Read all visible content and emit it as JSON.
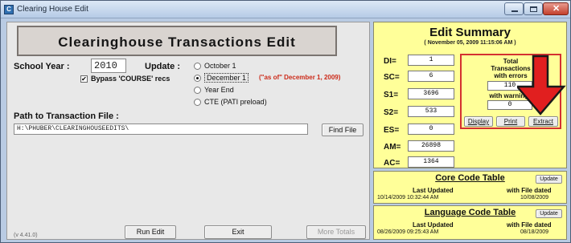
{
  "window": {
    "title": "Clearing House Edit",
    "app_icon": "app-icon"
  },
  "header": {
    "title": "Clearinghouse Transactions Edit"
  },
  "form": {
    "school_year_label": "School Year :",
    "school_year_value": "2010",
    "update_label": "Update :",
    "bypass_label": "Bypass 'COURSE' recs",
    "bypass_checked": true,
    "radio_options": [
      {
        "label": "October 1",
        "selected": false
      },
      {
        "label": "December 1",
        "selected": true
      },
      {
        "label": "Year End",
        "selected": false
      },
      {
        "label": "CTE (PATI preload)",
        "selected": false
      }
    ],
    "as_of_note": "(\"as of\" December 1, 2009)",
    "path_label": "Path to Transaction File :",
    "path_value": "H:\\PHUBER\\CLEARINGHOUSEEDITS\\",
    "find_file_label": "Find File"
  },
  "footer": {
    "version": "(v 4.41.0)",
    "run_edit_label": "Run Edit",
    "exit_label": "Exit",
    "more_totals_label": "More Totals"
  },
  "summary": {
    "title": "Edit Summary",
    "date": "( November 05, 2009  11:15:06 AM )",
    "codes": [
      {
        "label": "DI=",
        "value": "1"
      },
      {
        "label": "SC=",
        "value": "6"
      },
      {
        "label": "S1=",
        "value": "3696"
      },
      {
        "label": "S2=",
        "value": "533"
      },
      {
        "label": "ES=",
        "value": "0"
      },
      {
        "label": "AM=",
        "value": "26898"
      },
      {
        "label": "AC=",
        "value": "1364"
      }
    ],
    "totals": {
      "line1": "Total",
      "line2": "Transactions",
      "line3": "with errors",
      "errors_value": "110",
      "warnings_label": "with warnings",
      "warnings_value": "0",
      "display_label": "Display",
      "print_label": "Print",
      "extract_label": "Extract"
    }
  },
  "core_code": {
    "title": "Core Code Table",
    "update_label": "Update",
    "col1": "Last Updated",
    "col2": "with File dated",
    "last_updated": "10/14/2009  10:32:44 AM",
    "file_dated": "10/08/2009"
  },
  "language_code": {
    "title": "Language Code Table",
    "update_label": "Update",
    "col1": "Last Updated",
    "col2": "with File dated",
    "last_updated": "08/26/2009  09:25:43 AM",
    "file_dated": "08/18/2009"
  },
  "colors": {
    "accent_red": "#d43131",
    "panel_yellow": "#ffff99",
    "note_red": "#cc2b1a"
  }
}
